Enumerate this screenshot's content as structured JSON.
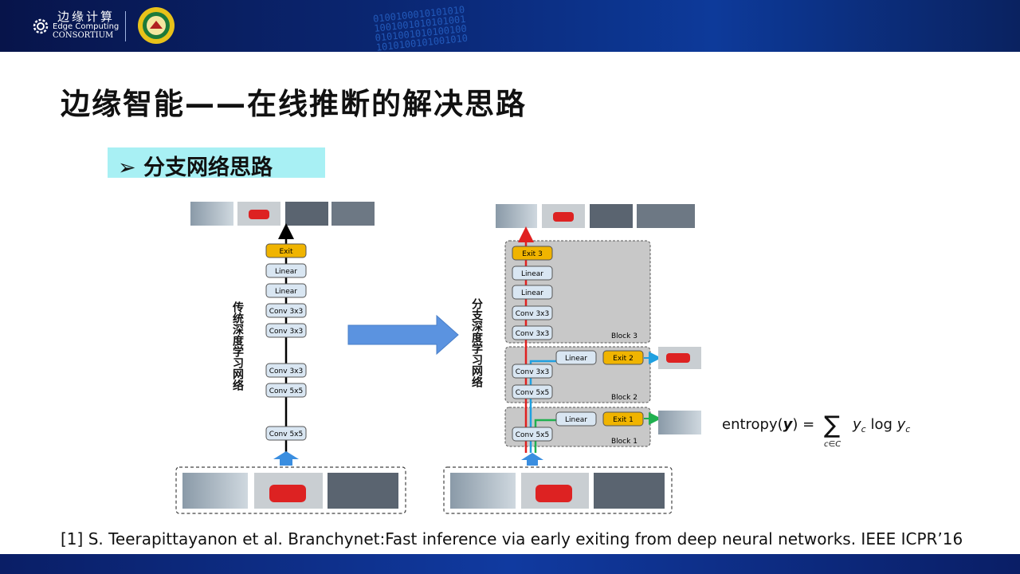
{
  "header": {
    "logo_cn": "边缘计算",
    "logo_en_1": "Edge Computing",
    "logo_en_2": "CONSORTIUM",
    "binary_lines": [
      "0100100010101010",
      "1001001010101001",
      "0101001010100100",
      "1010100101001010"
    ]
  },
  "title": "边缘智能——在线推断的解决思路",
  "subtitle": "➢ 分支网络思路",
  "left_label": "传统深度学习网络",
  "right_label": "分支深度学习网络",
  "left_stack": [
    "Exit",
    "Linear",
    "Linear",
    "Conv 3x3",
    "Conv 3x3",
    "Conv 3x3",
    "Conv 5x5",
    "Conv 5x5"
  ],
  "right_block3": [
    "Exit 3",
    "Linear",
    "Linear",
    "Conv 3x3",
    "Conv 3x3"
  ],
  "right_block2": [
    "Conv 3x3",
    "Conv 5x5"
  ],
  "right_block1": [
    "Conv 5x5"
  ],
  "branch2": {
    "linear": "Linear",
    "exit": "Exit 2"
  },
  "branch1": {
    "linear": "Linear",
    "exit": "Exit 1"
  },
  "block_labels": [
    "Block 3",
    "Block 2",
    "Block 1"
  ],
  "formula": {
    "lhs": "entropy(",
    "var": "y",
    "rhs": ") =",
    "sum": "∑",
    "sub": "c∈C",
    "term": "y",
    "term_sub": "c",
    "log": " log ",
    "term2": "y",
    "term2_sub": "c"
  },
  "colors": {
    "exit_fill": "#f0b400",
    "layer_fill": "#d9e6f2",
    "arrow_blue": "#5b93e0",
    "red_path": "#e02020",
    "blue_path": "#20a0e0",
    "green_path": "#20b050",
    "subtitle_bg": "#a8f0f4"
  },
  "reference": "[1] S. Teerapittayanon et al. Branchynet:Fast inference via early exiting from deep neural networks. IEEE ICPR’16"
}
